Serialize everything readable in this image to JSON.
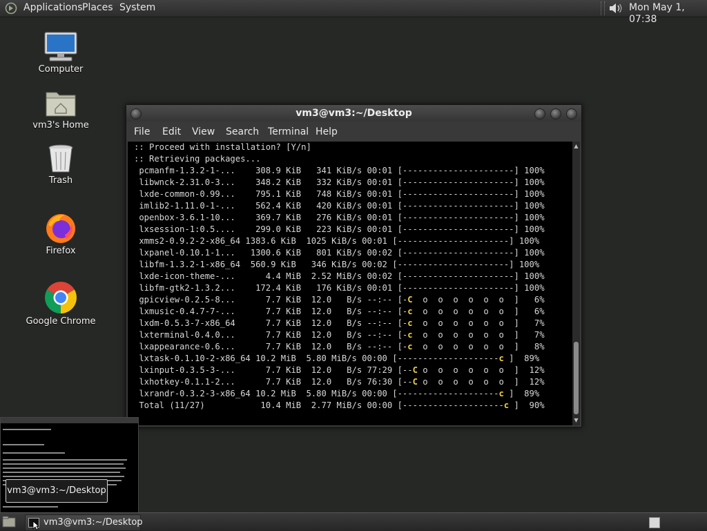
{
  "top_panel": {
    "menus": [
      "Applications",
      "Places",
      "System"
    ],
    "clock": "Mon May  1, 07:38",
    "icons": [
      "distro-logo",
      "volume-icon"
    ]
  },
  "desktop": {
    "icons": [
      {
        "label": "Computer",
        "icon": "computer-icon"
      },
      {
        "label": "vm3's Home",
        "icon": "home-folder-icon"
      },
      {
        "label": "Trash",
        "icon": "trash-icon"
      },
      {
        "label": "Firefox",
        "icon": "firefox-icon"
      },
      {
        "label": "Google Chrome",
        "icon": "chrome-icon"
      }
    ]
  },
  "terminal": {
    "title": "vm3@vm3:~/Desktop",
    "menu": [
      "File",
      "Edit",
      "View",
      "Search",
      "Terminal",
      "Help"
    ],
    "lines": [
      ":: Proceed with installation? [Y/n]",
      ":: Retrieving packages...",
      " pcmanfm-1.3.2-1-...    308.9 KiB   341 KiB/s 00:01 [----------------------] 100%",
      " libwnck-2.31.0-3...    348.2 KiB   332 KiB/s 00:01 [----------------------] 100%",
      " lxde-common-0.99...    795.1 KiB   748 KiB/s 00:01 [----------------------] 100%",
      " imlib2-1.11.0-1-...    562.4 KiB   420 KiB/s 00:01 [----------------------] 100%",
      " openbox-3.6.1-10...    369.7 KiB   276 KiB/s 00:01 [----------------------] 100%",
      " lxsession-1:0.5....    299.0 KiB   223 KiB/s 00:01 [----------------------] 100%",
      " xmms2-0.9.2-2-x86_64 1383.6 KiB  1025 KiB/s 00:01 [----------------------] 100%",
      " lxpanel-0.10.1-1...   1300.6 KiB   801 KiB/s 00:02 [----------------------] 100%",
      " libfm-1.3.2-1-x86_64  560.9 KiB   346 KiB/s 00:02 [----------------------] 100%",
      " lxde-icon-theme-...      4.4 MiB  2.52 MiB/s 00:02 [----------------------] 100%",
      " libfm-gtk2-1.3.2...    172.4 KiB   176 KiB/s 00:01 [----------------------] 100%",
      " gpicview-0.2.5-8...      7.7 KiB  12.0   B/s --:-- [-C  o  o  o  o  o  o  ]   6%",
      " lxmusic-0.4.7-7-...      7.7 KiB  12.0   B/s --:-- [-c  o  o  o  o  o  o  ]   6%",
      " lxdm-0.5.3-7-x86_64      7.7 KiB  12.0   B/s --:-- [-c  o  o  o  o  o  o  ]   7%",
      " lxterminal-0.4.0...      7.7 KiB  12.0   B/s --:-- [-c  o  o  o  o  o  o  ]   7%",
      " lxappearance-0.6...      7.7 KiB  12.0   B/s --:-- [-c  o  o  o  o  o  o  ]   8%",
      " lxtask-0.1.10-2-x86_64 10.2 MiB  5.80 MiB/s 00:00 [--------------------c ]  89%",
      " lxinput-0.3.5-3-...      7.7 KiB  12.0   B/s 77:29 [--C o  o  o  o  o  o  ]  12%",
      " lxhotkey-0.1.1-2...      7.7 KiB  12.0   B/s 76:30 [--C o  o  o  o  o  o  ]  12%",
      " lxrandr-0.3.2-3-x86_64 10.2 MiB  5.80 MiB/s 00:00 [--------------------c ]  89%",
      " Total (11/27)           10.4 MiB  2.77 MiB/s 00:00 [--------------------c ]  90%"
    ]
  },
  "preview": {
    "tooltip": "vm3@vm3:~/Desktop"
  },
  "bottom_panel": {
    "task_label": "vm3@vm3:~/Desktop"
  }
}
